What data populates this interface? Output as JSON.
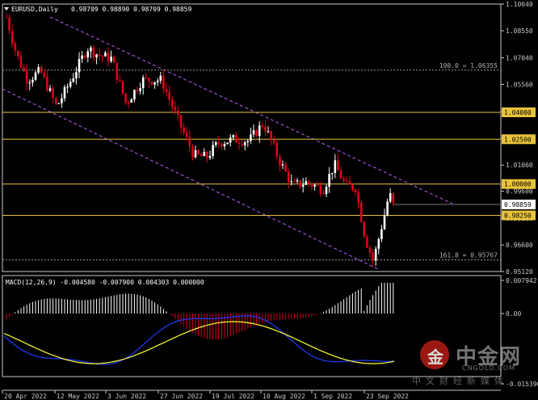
{
  "header": {
    "symbol_label": "EURUSD,Daily",
    "ohlc": "0.98709 0.98890 0.98709 0.98859",
    "collapse_icon": "triangle-down-icon"
  },
  "price_axis": {
    "ticks": [
      "1.10040",
      "1.08550",
      "1.07040",
      "1.05560",
      "1.04060",
      "1.02560",
      "1.01060",
      "0.99600",
      "0.98100",
      "0.96600",
      "0.95120"
    ],
    "current_price": "0.98859",
    "current_color": "#ffffff"
  },
  "levels": [
    {
      "value": "1.04000",
      "color": "#e8c23a"
    },
    {
      "value": "1.02500",
      "color": "#e8c23a"
    },
    {
      "value": "1.00000",
      "color": "#e8c23a"
    },
    {
      "value": "0.98250",
      "color": "#e8c23a"
    }
  ],
  "fibo": [
    {
      "label": "100.0 = 1.06355"
    },
    {
      "label": "161.8 = 0.95767"
    }
  ],
  "channel_color": "#b460ff",
  "candle_colors": {
    "bull": "#ffffff",
    "bear": "#e0001a"
  },
  "macd": {
    "label": "MACD(12,26,9) -0.004580 -0.007900 0.004303 0.000000",
    "ticks": [
      "0.007942",
      "0.00",
      "-0.015396"
    ],
    "hist_pos_color": "#ffffff",
    "hist_neg_color": "#e0001a",
    "line_color": "#1f3cff",
    "signal_color": "#ffff33"
  },
  "time_axis": [
    "20 Apr 2022",
    "12 May 2022",
    "3 Jun 2022",
    "27 Jun 2022",
    "19 Jul 2022",
    "10 Aug 2022",
    "1 Sep 2022",
    "23 Sep 2022"
  ],
  "watermark": {
    "logo_char": "金",
    "name": "中金网",
    "domain": "CNGOLD.COM",
    "tagline": "中文财经新媒体"
  }
}
